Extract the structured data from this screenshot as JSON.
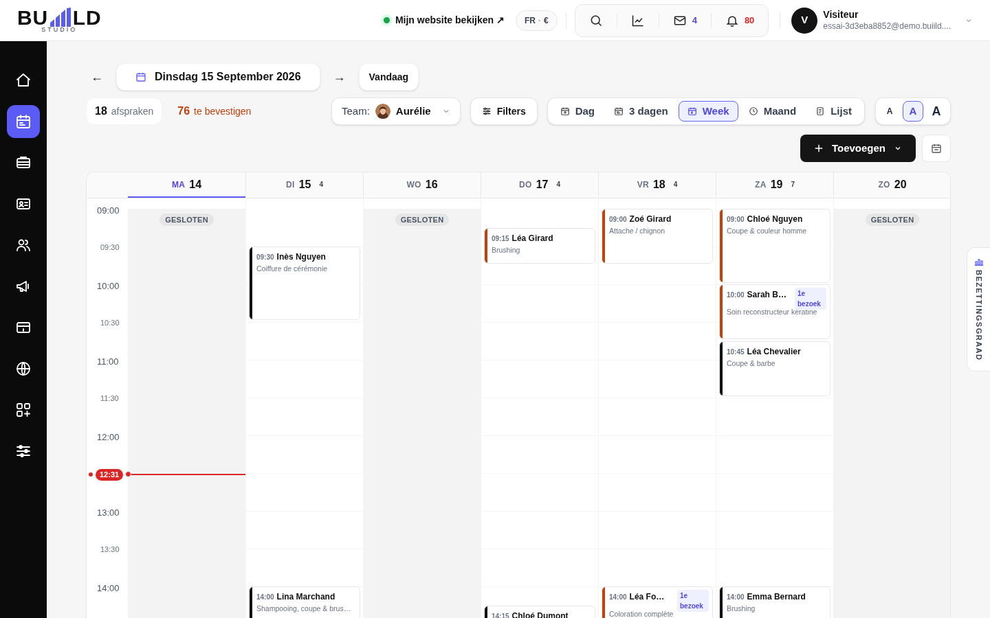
{
  "logo": {
    "left": "BU",
    "right": "LD",
    "sub": "STUDIO"
  },
  "header": {
    "website_link": "Mijn website bekijken ↗",
    "locale": "FR",
    "separator": "·",
    "currency": "€",
    "mail_count": "4",
    "notification_count": "80",
    "user": {
      "initial": "V",
      "name": "Visiteur",
      "email": "essai-3d3eba8852@demo.buiild...."
    }
  },
  "sidebar": {
    "items": [
      {
        "kind": "home",
        "selected": false
      },
      {
        "kind": "calendar",
        "selected": true
      },
      {
        "kind": "stack",
        "selected": false
      },
      {
        "kind": "idcard",
        "selected": false
      },
      {
        "kind": "users",
        "selected": false
      },
      {
        "kind": "megaphone",
        "selected": false
      },
      {
        "kind": "register",
        "selected": false
      },
      {
        "kind": "globe",
        "selected": false
      },
      {
        "kind": "apps",
        "selected": false
      },
      {
        "kind": "sliders",
        "selected": false
      }
    ]
  },
  "date_nav": {
    "prev": "←",
    "date": "Dinsdag 15 September 2026",
    "next": "→",
    "today": "Vandaag"
  },
  "stats": {
    "appointments_count": "18",
    "appointments_label": "afspraken",
    "pending_count": "76",
    "pending_label": "te bevestigen"
  },
  "team": {
    "label": "Team:",
    "member": "Aurélie"
  },
  "filters": "Filters",
  "views": [
    {
      "label": "Dag",
      "kind": "day",
      "selected": false
    },
    {
      "label": "3 dagen",
      "kind": "threedays",
      "selected": false
    },
    {
      "label": "Week",
      "kind": "week",
      "selected": true
    },
    {
      "label": "Maand",
      "kind": "month",
      "selected": false
    },
    {
      "label": "Lijst",
      "kind": "list",
      "selected": false
    }
  ],
  "font_sizes": [
    {
      "label": "A",
      "selected": false
    },
    {
      "label": "A",
      "selected": true
    },
    {
      "label": "A",
      "selected": false
    }
  ],
  "add_button": "Toevoegen",
  "time_slots": [
    "09:00",
    "09:30",
    "10:00",
    "10:30",
    "11:00",
    "11:30",
    "12:00",
    "13:00",
    "13:30",
    "14:00"
  ],
  "now": "12:31",
  "days": [
    {
      "weekday": "MA",
      "day": "14",
      "selected": true,
      "closed": true,
      "closed_label": "GESLOTEN"
    },
    {
      "weekday": "DI",
      "day": "15",
      "count": "4",
      "selected": false,
      "closed": false,
      "events": [
        {
          "time": "09:30",
          "name": "Inès Nguyen",
          "service": "Coiffure de cérémonie",
          "color": "#111111"
        },
        {
          "time": "14:00",
          "name": "Lina Marchand",
          "service": "Shampooing, coupe & brus…",
          "color": "#111111"
        }
      ]
    },
    {
      "weekday": "WO",
      "day": "16",
      "selected": false,
      "closed": true,
      "closed_label": "GESLOTEN"
    },
    {
      "weekday": "DO",
      "day": "17",
      "count": "4",
      "selected": false,
      "closed": false,
      "events": [
        {
          "time": "09:15",
          "name": "Léa Girard",
          "service": "Brushing",
          "color": "#c2410c"
        },
        {
          "time": "14:15",
          "name": "Chloé Dumont",
          "color": "#111111"
        }
      ]
    },
    {
      "weekday": "VR",
      "day": "18",
      "count": "4",
      "selected": false,
      "closed": false,
      "events": [
        {
          "time": "09:00",
          "name": "Zoé Girard",
          "service": "Attache / chignon",
          "color": "#c2410c"
        },
        {
          "time": "14:00",
          "name": "Léa Fo…",
          "badge": "1e bezoek",
          "service": "Coloration complète",
          "color": "#c2410c"
        }
      ]
    },
    {
      "weekday": "ZA",
      "day": "19",
      "count": "7",
      "selected": false,
      "closed": false,
      "events": [
        {
          "time": "09:00",
          "name": "Chloé Nguyen",
          "service": "Coupe & couleur homme",
          "color": "#c2410c"
        },
        {
          "time": "10:00",
          "name": "Sarah B…",
          "badge": "1e bezoek",
          "service": "Soin reconstructeur kératine",
          "color": "#c2410c"
        },
        {
          "time": "10:45",
          "name": "Léa Chevalier",
          "service": "Coupe & barbe",
          "color": "#111111"
        },
        {
          "time": "14:00",
          "name": "Emma Bernard",
          "service": "Brushing",
          "color": "#111111"
        }
      ]
    },
    {
      "weekday": "ZO",
      "day": "20",
      "selected": false,
      "closed": true,
      "closed_label": "GESLOTEN"
    }
  ],
  "side_tab": "BEZETTINGSGRAAD"
}
